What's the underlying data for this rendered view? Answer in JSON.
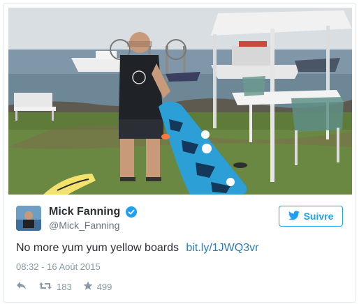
{
  "tweet": {
    "author_name": "Mick Fanning",
    "author_handle": "@Mick_Fanning",
    "follow_label": "Suivre",
    "text": "No more yum yum yellow boards",
    "link": "bit.ly/1JWQ3vr",
    "timestamp": "08:32 - 16 Août 2015",
    "retweets": "183",
    "likes": "499"
  },
  "colors": {
    "accent": "#1da1f2",
    "link": "#2b7bb9",
    "text": "#292f33",
    "muted": "#8899a6"
  },
  "icons": [
    "verified-badge-icon",
    "twitter-bird-icon",
    "reply-icon",
    "retweet-icon",
    "star-icon"
  ]
}
